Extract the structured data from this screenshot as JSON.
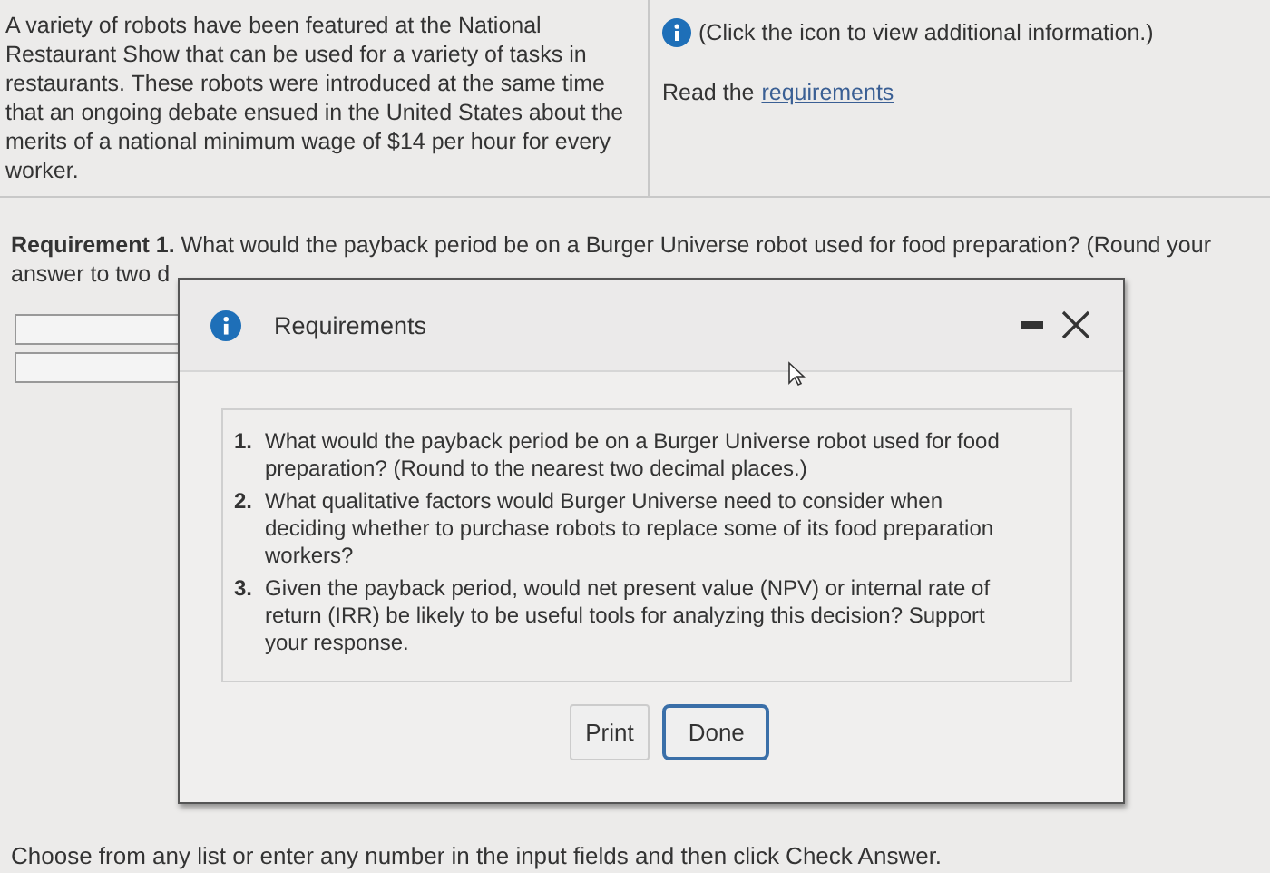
{
  "intro": "A variety of robots have been featured at the National Restaurant Show that can be used for a variety of tasks in restaurants. These robots were introduced at the same time that an ongoing debate ensued in the United States about the merits of a national minimum wage of $14 per hour for every worker.",
  "info_note": "(Click the icon to view additional information.)",
  "read_prefix": "Read the",
  "read_link": "requirements",
  "requirement": "**Requirement 1.** What would the payback period be on a Burger Universe robot used for food preparation? (Round your answer to two d",
  "dialog": {
    "title": "Requirements",
    "items": [
      {
        "number": "1.",
        "text": "What would the payback period be on a Burger Universe robot used for food preparation? (Round to the nearest two decimal places.)"
      },
      {
        "number": "2.",
        "text": "What qualitative factors would Burger Universe need to consider when deciding whether to purchase robots to replace some of its food preparation workers?"
      },
      {
        "number": "3.",
        "text": "Given the payback period, would net present value (NPV) or internal rate of return (IRR) be likely to be useful tools for analyzing this decision? Support your response."
      }
    ],
    "buttons": [
      {
        "label": "Print",
        "selected": false
      },
      {
        "label": "Done",
        "selected": true
      }
    ]
  },
  "footer": "Choose from any list or enter any number in the input fields and then click Check Answer."
}
